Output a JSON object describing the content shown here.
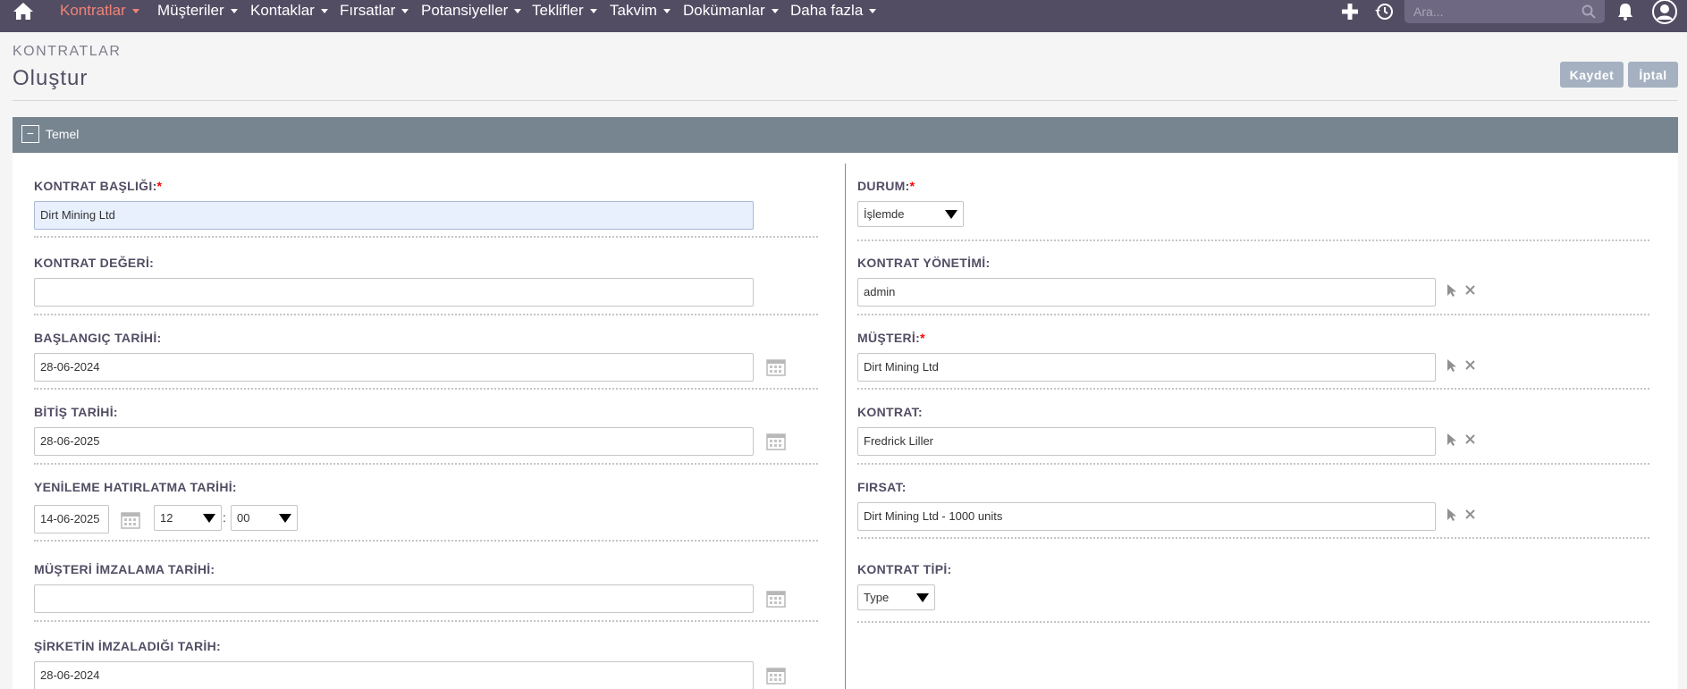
{
  "nav": {
    "items": [
      {
        "label": "Kontratlar",
        "active": true
      },
      {
        "label": "Müşteriler"
      },
      {
        "label": "Kontaklar"
      },
      {
        "label": "Fırsatlar"
      },
      {
        "label": "Potansiyeller"
      },
      {
        "label": "Teklifler"
      },
      {
        "label": "Takvim"
      },
      {
        "label": "Dokümanlar"
      },
      {
        "label": "Daha fazla"
      }
    ],
    "search_placeholder": "Ara...",
    "icons": [
      "home-icon",
      "plus-icon",
      "history-icon",
      "search-icon",
      "bell-icon",
      "user-icon"
    ]
  },
  "header": {
    "module": "KONTRATLAR",
    "title": "Oluştur",
    "save_label": "Kaydet",
    "cancel_label": "İptal"
  },
  "panel": {
    "title": "Temel",
    "collapse_symbol": "−"
  },
  "form": {
    "left": {
      "contract_title": {
        "label": "KONTRAT BAŞLIĞI:",
        "required": "*",
        "value": "Dirt Mining Ltd"
      },
      "contract_value": {
        "label": "KONTRAT DEĞERİ:",
        "value": ""
      },
      "start_date": {
        "label": "BAŞLANGIÇ TARİHİ:",
        "value": "28-06-2024"
      },
      "end_date": {
        "label": "BİTİŞ TARİHİ:",
        "value": "28-06-2025"
      },
      "renewal_reminder": {
        "label": "YENİLEME HATIRLATMA TARİHİ:",
        "date": "14-06-2025",
        "hour": "12",
        "separator": ":",
        "minute": "00"
      },
      "customer_signed": {
        "label": "MÜŞTERİ İMZALAMA TARİHİ:",
        "value": ""
      },
      "company_signed": {
        "label": "ŞİRKETİN İMZALADIĞI TARİH:",
        "value": "28-06-2024"
      }
    },
    "right": {
      "status": {
        "label": "DURUM:",
        "required": "*",
        "value": "İşlemde"
      },
      "contract_manager": {
        "label": "KONTRAT YÖNETİMİ:",
        "value": "admin"
      },
      "customer": {
        "label": "MÜŞTERİ:",
        "required": "*",
        "value": "Dirt Mining Ltd"
      },
      "contact": {
        "label": "KONTRAT:",
        "value": "Fredrick Liller"
      },
      "opportunity": {
        "label": "FIRSAT:",
        "value": "Dirt Mining Ltd - 1000 units"
      },
      "contract_type": {
        "label": "KONTRAT TİPİ:",
        "value": "Type"
      }
    }
  },
  "colors": {
    "nav_bg": "#534d64",
    "nav_active": "#f08377",
    "panel_header": "#778591",
    "button_bg": "#a5b1c1",
    "required": "#ff0000"
  }
}
